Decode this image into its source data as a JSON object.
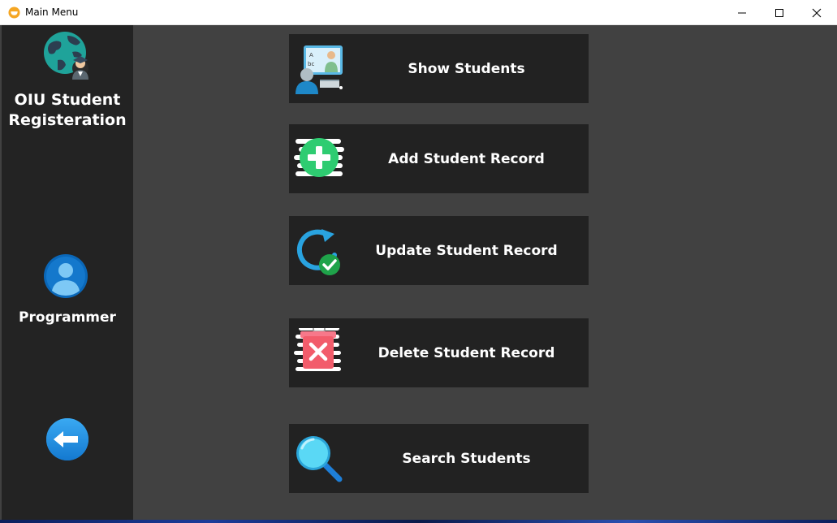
{
  "window": {
    "title": "Main Menu"
  },
  "sidebar": {
    "app_name": "OIU Student\nRegisteration",
    "programmer_label": "Programmer",
    "logo_icon": "globe-graduate-icon",
    "programmer_icon": "user-avatar-icon",
    "back_icon": "back-arrow-icon"
  },
  "menu": {
    "show_students": "Show Students",
    "add_record": "Add Student Record",
    "update_record": "Update Student Record",
    "delete_record": "Delete Student Record",
    "search_students": "Search Students"
  },
  "colors": {
    "sidebar_bg": "#232323",
    "main_bg": "#414141",
    "button_bg": "#222222",
    "add_green": "#2ecc71",
    "update_blue": "#29a3e0",
    "delete_red": "#f25c6b",
    "search_cyan": "#5ad8f5"
  }
}
